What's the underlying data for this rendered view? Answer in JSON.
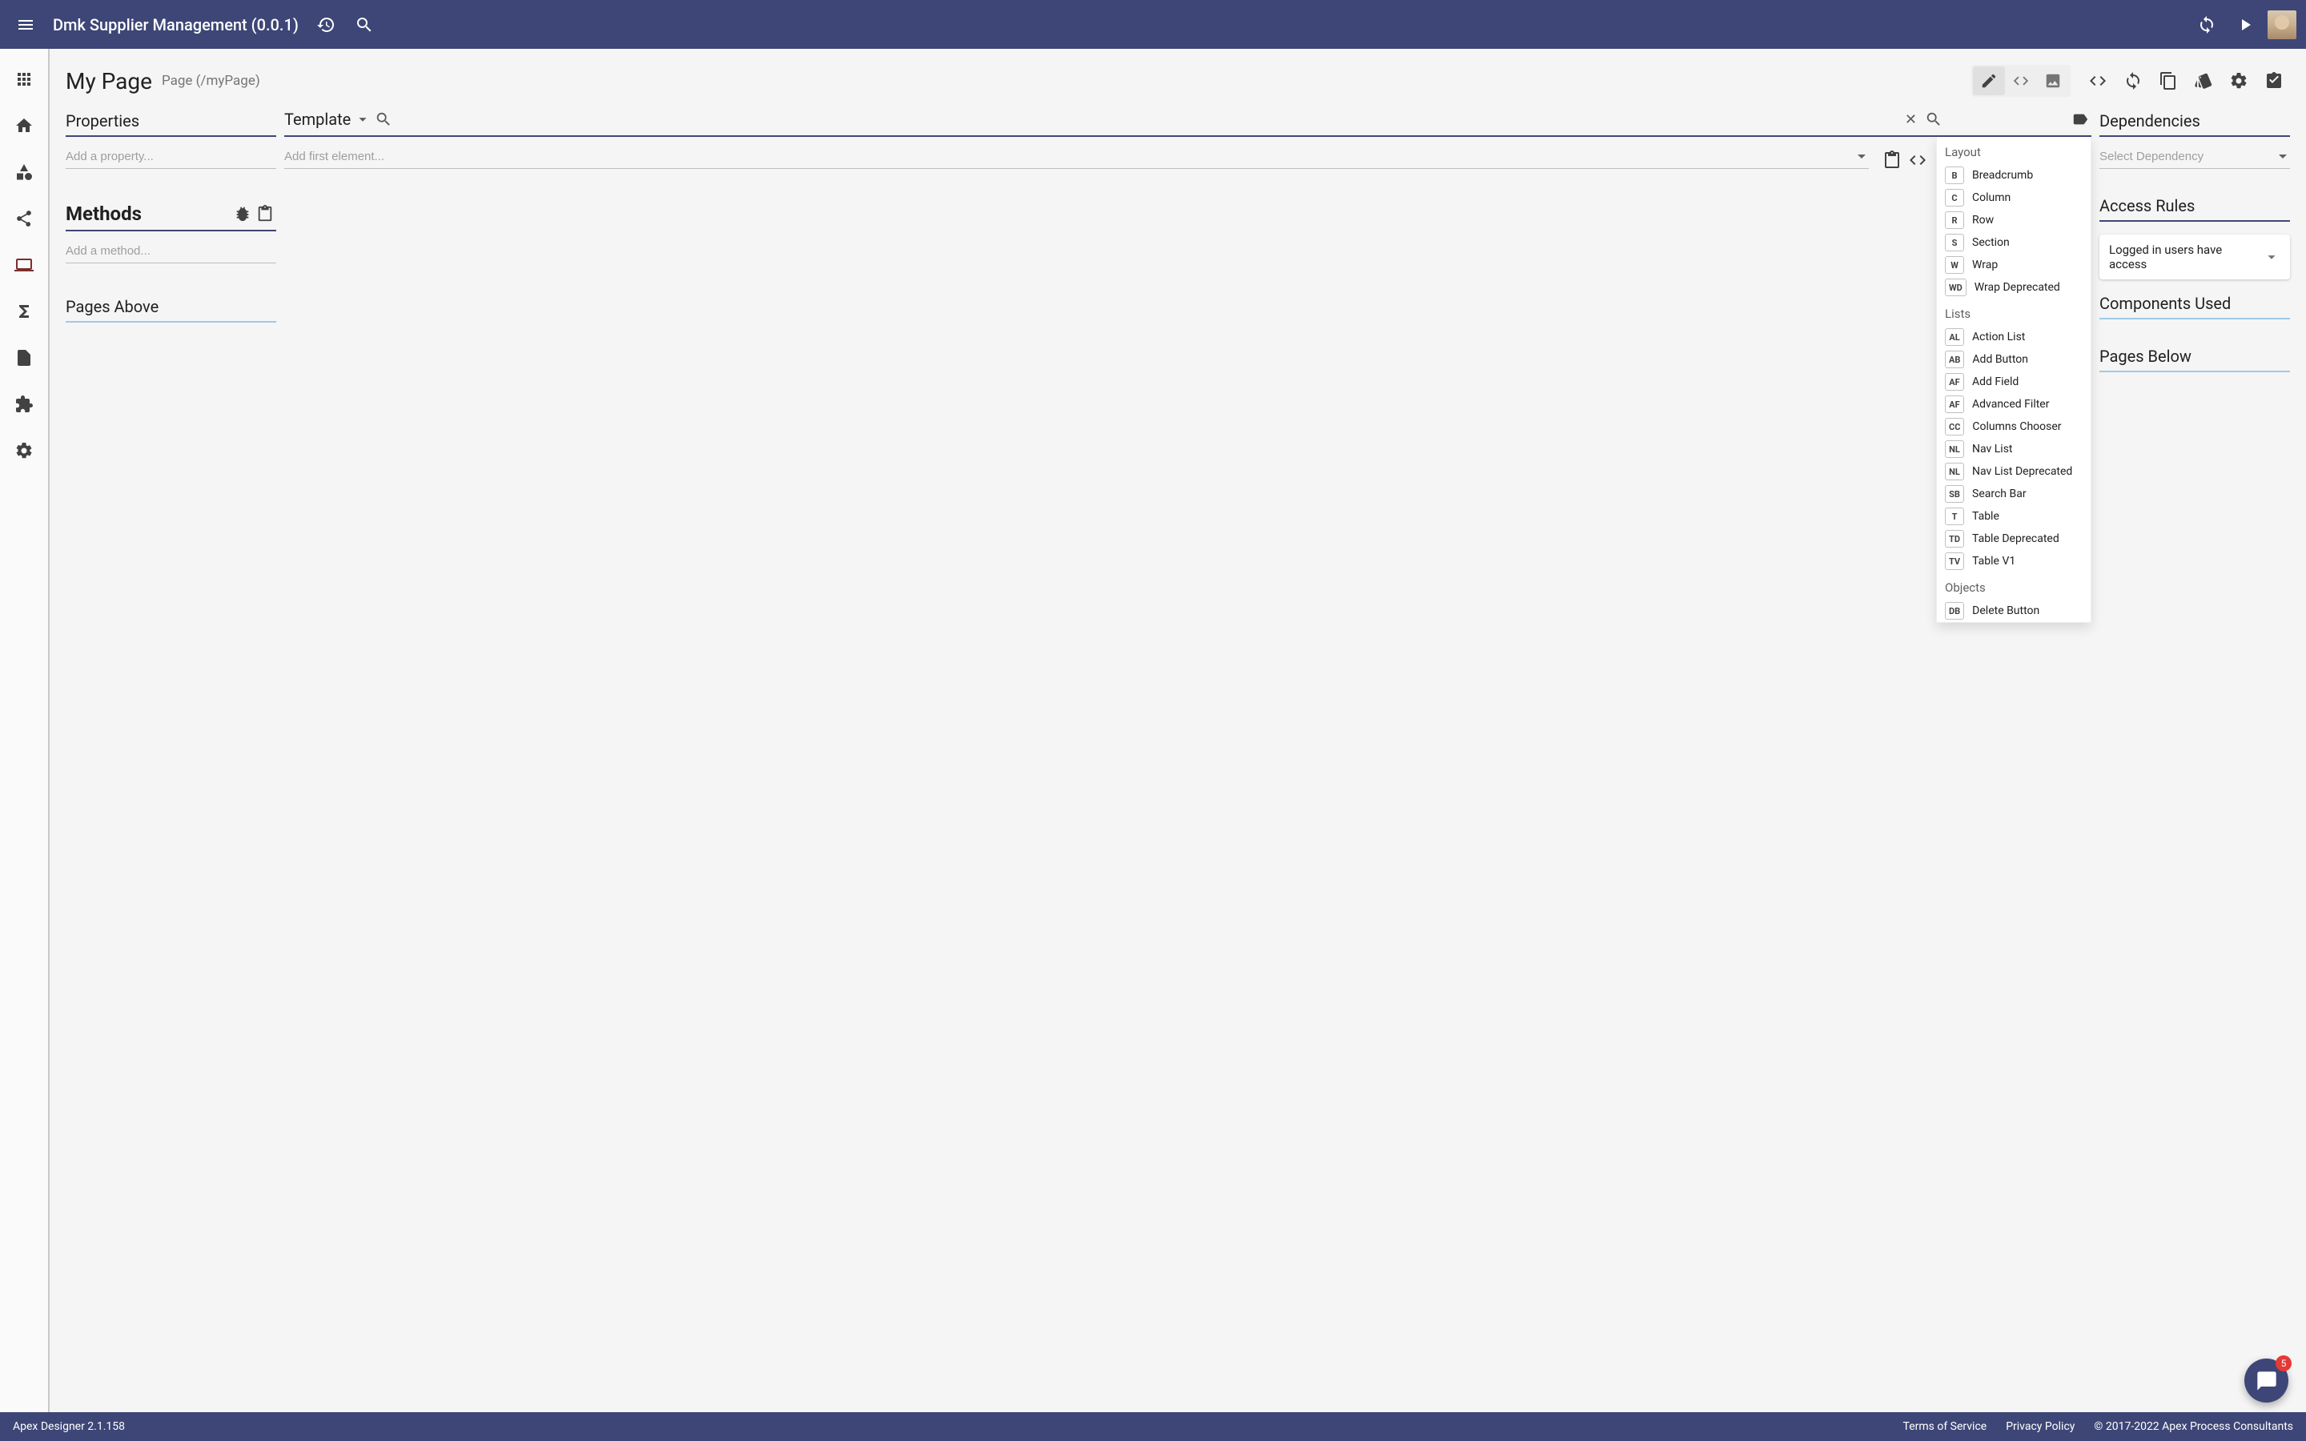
{
  "appbar": {
    "title": "Dmk Supplier Management (0.0.1)"
  },
  "page": {
    "title": "My Page",
    "subtitle": "Page (/myPage)"
  },
  "properties": {
    "heading": "Properties",
    "add_placeholder": "Add a property..."
  },
  "methods": {
    "heading": "Methods",
    "add_placeholder": "Add a method..."
  },
  "pages_above": {
    "heading": "Pages Above"
  },
  "template": {
    "heading": "Template",
    "add_first_element_placeholder": "Add first element..."
  },
  "palette": {
    "groups": [
      {
        "label": "Layout",
        "items": [
          {
            "badge": "B",
            "name": "Breadcrumb"
          },
          {
            "badge": "C",
            "name": "Column"
          },
          {
            "badge": "R",
            "name": "Row"
          },
          {
            "badge": "S",
            "name": "Section"
          },
          {
            "badge": "W",
            "name": "Wrap"
          },
          {
            "badge": "WD",
            "name": "Wrap Deprecated"
          }
        ]
      },
      {
        "label": "Lists",
        "items": [
          {
            "badge": "AL",
            "name": "Action List"
          },
          {
            "badge": "AB",
            "name": "Add Button"
          },
          {
            "badge": "AF",
            "name": "Add Field"
          },
          {
            "badge": "AF",
            "name": "Advanced Filter"
          },
          {
            "badge": "CC",
            "name": "Columns Chooser"
          },
          {
            "badge": "NL",
            "name": "Nav List"
          },
          {
            "badge": "NL",
            "name": "Nav List Deprecated"
          },
          {
            "badge": "SB",
            "name": "Search Bar"
          },
          {
            "badge": "T",
            "name": "Table"
          },
          {
            "badge": "TD",
            "name": "Table Deprecated"
          },
          {
            "badge": "TV",
            "name": "Table V1"
          }
        ]
      },
      {
        "label": "Objects",
        "items": [
          {
            "badge": "DB",
            "name": "Delete Button"
          }
        ]
      }
    ]
  },
  "dependencies": {
    "heading": "Dependencies",
    "select_placeholder": "Select Dependency"
  },
  "access_rules": {
    "heading": "Access Rules",
    "rule": "Logged in users have access"
  },
  "components_used": {
    "heading": "Components Used"
  },
  "pages_below": {
    "heading": "Pages Below"
  },
  "footer": {
    "version": "Apex Designer 2.1.158",
    "tos": "Terms of Service",
    "privacy": "Privacy Policy",
    "copyright": "© 2017-2022 Apex Process Consultants"
  },
  "chat": {
    "badge": "5"
  }
}
